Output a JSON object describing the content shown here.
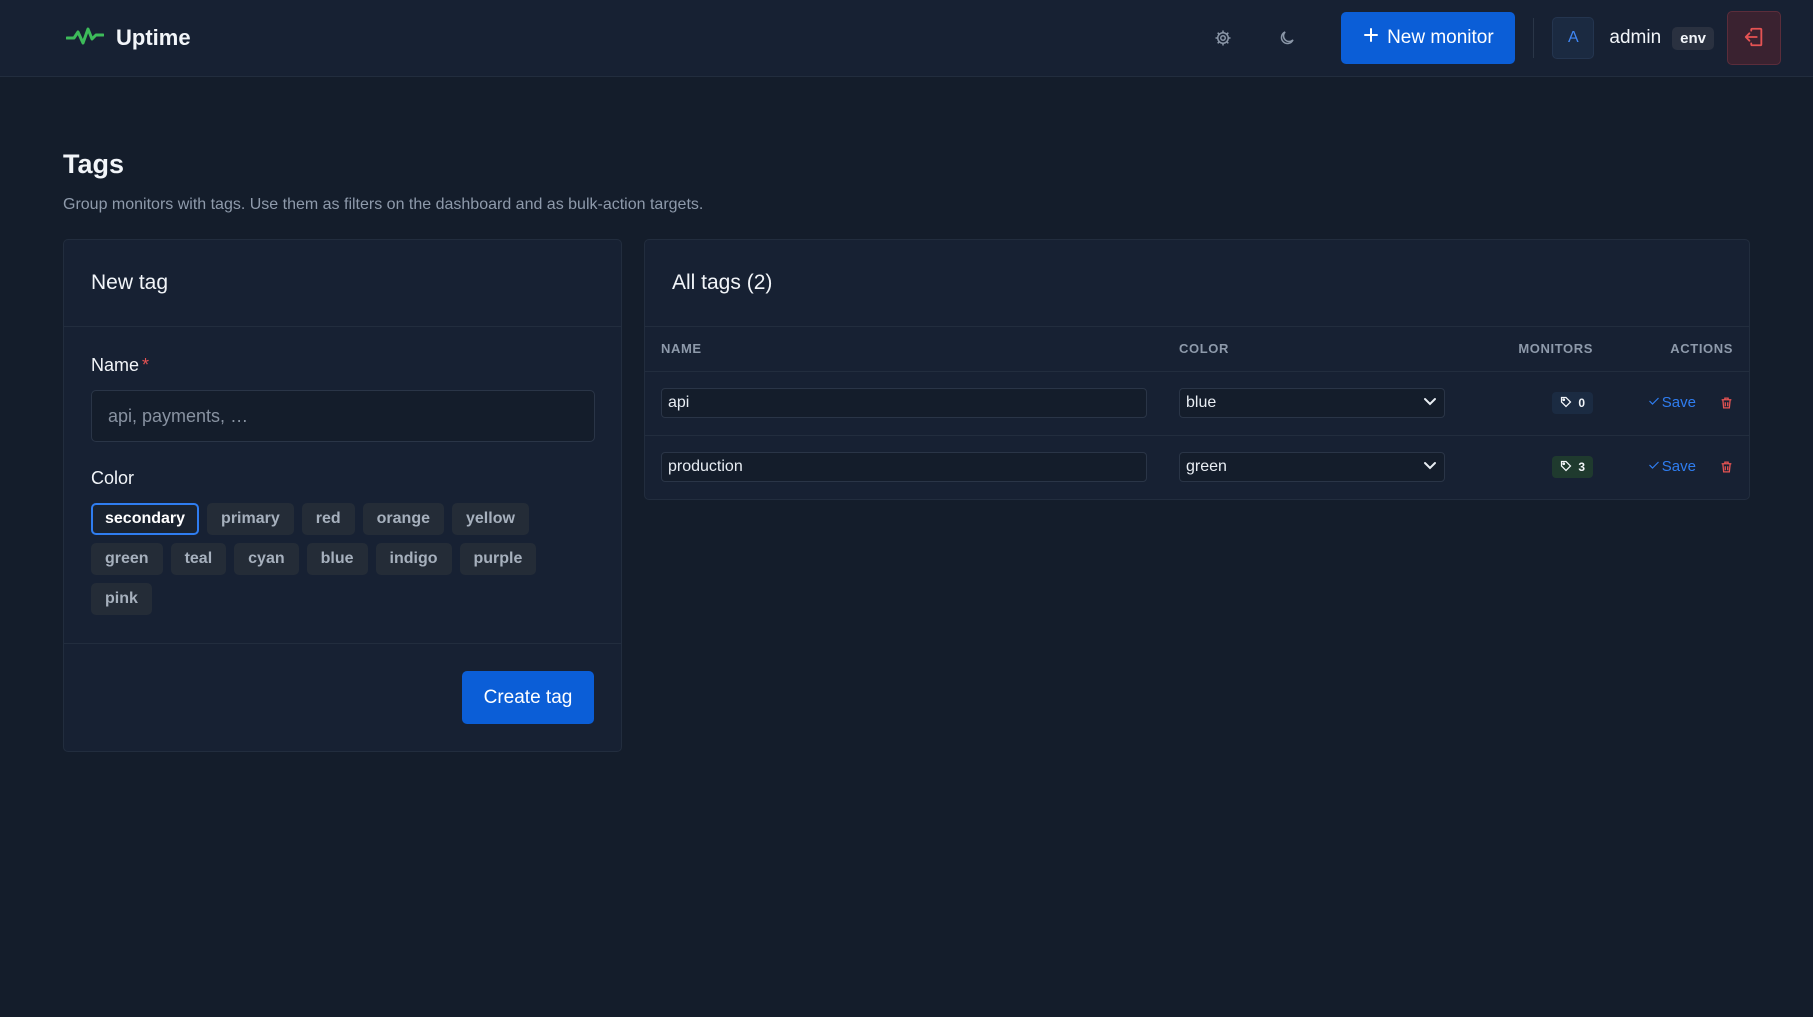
{
  "header": {
    "brand": "Uptime",
    "new_monitor_label": "New monitor",
    "avatar_initial": "A",
    "username": "admin",
    "env_badge": "env"
  },
  "page": {
    "title": "Tags",
    "subtitle": "Group monitors with tags. Use them as filters on the dashboard and as bulk-action targets."
  },
  "new_tag": {
    "title": "New tag",
    "name_label": "Name",
    "required_mark": "*",
    "name_placeholder": "api, payments, …",
    "color_label": "Color",
    "colors": [
      "secondary",
      "primary",
      "red",
      "orange",
      "yellow",
      "green",
      "teal",
      "cyan",
      "blue",
      "indigo",
      "purple",
      "pink"
    ],
    "selected_color": "secondary",
    "create_label": "Create tag"
  },
  "all_tags": {
    "title": "All tags (2)",
    "columns": {
      "name": "NAME",
      "color": "COLOR",
      "monitors": "MONITORS",
      "actions": "ACTIONS"
    },
    "rows": [
      {
        "name": "api",
        "color": "blue",
        "monitors": "0",
        "save_label": "Save"
      },
      {
        "name": "production",
        "color": "green",
        "monitors": "3",
        "save_label": "Save"
      }
    ]
  },
  "colors": {
    "accent": "#0b5ed7",
    "brand_icon": "#3dbb5a",
    "danger": "#e55353",
    "background": "#141d2b",
    "card": "#172133"
  },
  "icons": [
    "pulse-logo-icon",
    "gear-icon",
    "moon-icon",
    "plus-icon",
    "logout-icon",
    "tag-icon",
    "check-icon",
    "trash-icon",
    "chevron-down-icon"
  ]
}
